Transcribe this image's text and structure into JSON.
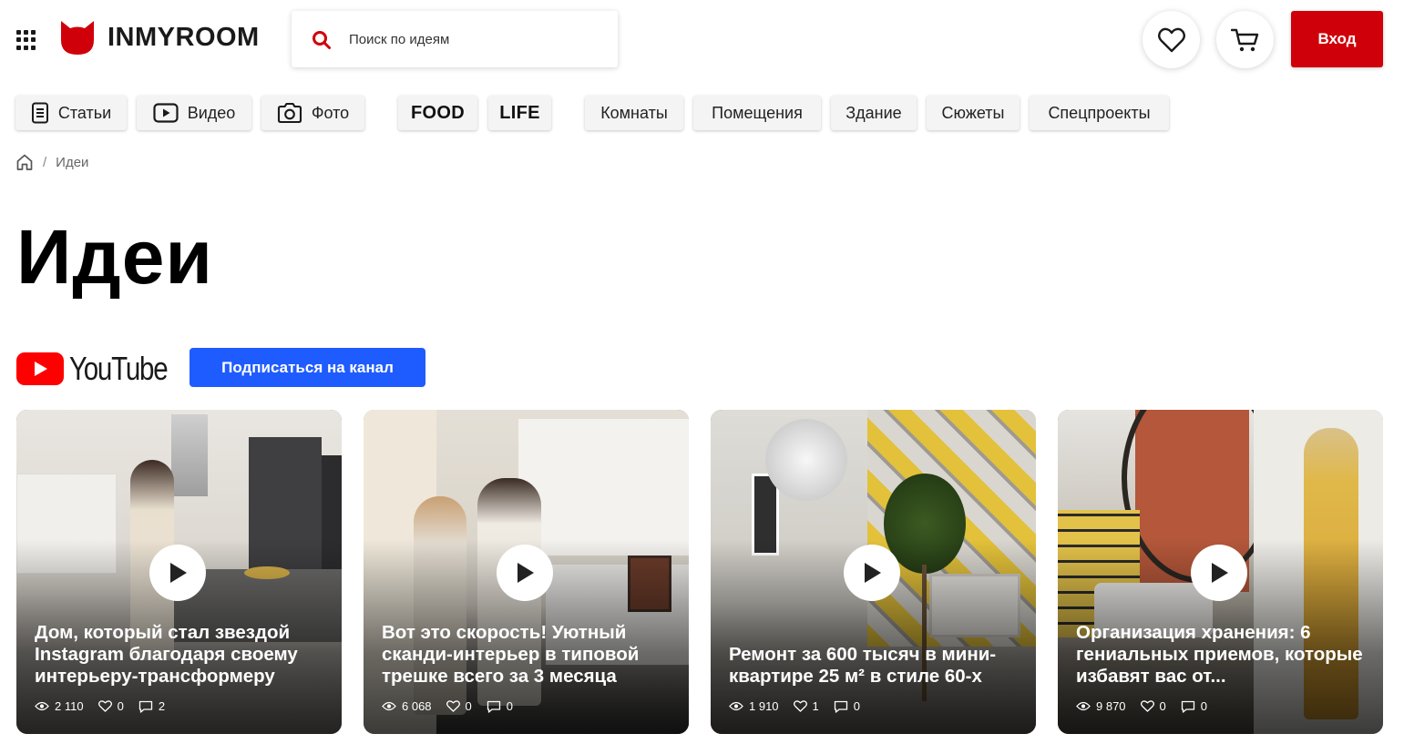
{
  "header": {
    "logo_text": "INMYROOM",
    "search_placeholder": "Поиск по идеям",
    "login_label": "Вход",
    "brand_color": "#d0000a"
  },
  "nav": {
    "primary": [
      {
        "label": "Статьи",
        "icon": "document-icon"
      },
      {
        "label": "Видео",
        "icon": "video-play-icon"
      },
      {
        "label": "Фото",
        "icon": "camera-icon"
      }
    ],
    "brands": [
      "FOOD",
      "LIFE"
    ],
    "sections": [
      "Комнаты",
      "Помещения",
      "Здание",
      "Сюжеты",
      "Спецпроекты"
    ]
  },
  "breadcrumb": {
    "current": "Идеи"
  },
  "page_title": "Идеи",
  "youtube": {
    "wordmark": "YouTube",
    "subscribe_label": "Подписаться на канал",
    "subscribe_color": "#1f5cff"
  },
  "videos": [
    {
      "title": "Дом, который стал звездой Instagram благодаря своему интерьеру-трансформеру",
      "views": "2 110",
      "likes": "0",
      "comments": "2"
    },
    {
      "title": "Вот это скорость! Уютный сканди-интерьер в типовой трешке всего за 3 месяца",
      "views": "6 068",
      "likes": "0",
      "comments": "0"
    },
    {
      "title": "Ремонт за 600 тысяч в мини-квартире 25 м² в стиле 60-х",
      "views": "1 910",
      "likes": "1",
      "comments": "0"
    },
    {
      "title": "Организация хранения: 6 гениальных приемов, которые избавят вас от...",
      "views": "9 870",
      "likes": "0",
      "comments": "0"
    }
  ]
}
